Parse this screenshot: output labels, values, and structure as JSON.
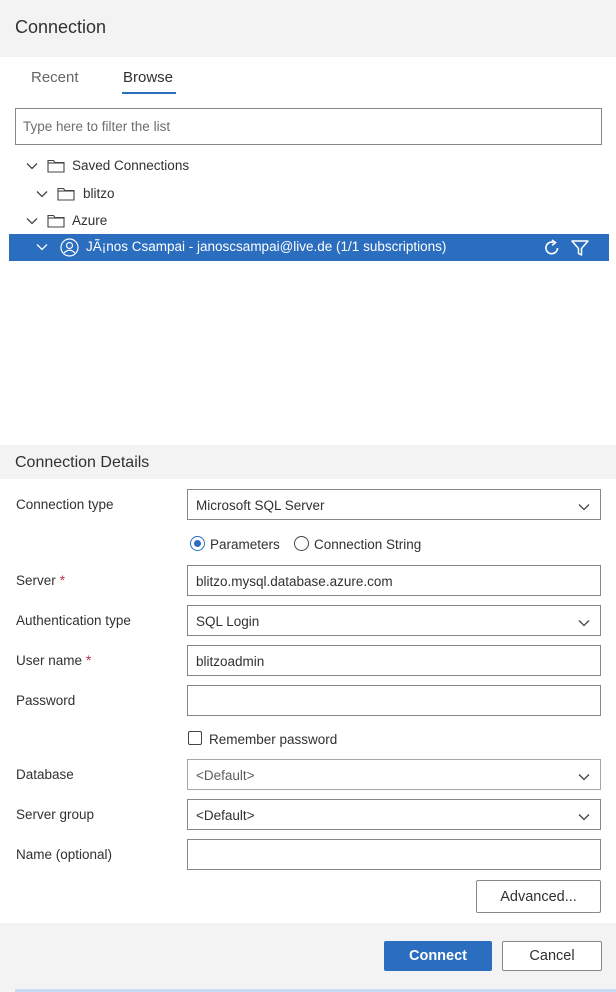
{
  "dialog": {
    "title": "Connection"
  },
  "tabs": [
    {
      "label": "Recent",
      "active": false
    },
    {
      "label": "Browse",
      "active": true
    }
  ],
  "filter": {
    "placeholder": "Type here to filter the list",
    "value": ""
  },
  "tree": {
    "saved_connections": "Saved Connections",
    "blitzo": "blitzo",
    "azure": "Azure",
    "account": "JÃ¡nos Csampai - janoscsampai@live.de (1/1 subscriptions)"
  },
  "details": {
    "title": "Connection Details",
    "connection_type": {
      "label": "Connection type",
      "value": "Microsoft SQL Server"
    },
    "input_mode": {
      "parameters": "Parameters",
      "connection_string": "Connection String",
      "selected": "Parameters"
    },
    "server": {
      "label": "Server",
      "required_mark": "*",
      "value": "blitzo.mysql.database.azure.com"
    },
    "auth_type": {
      "label": "Authentication type",
      "value": "SQL Login"
    },
    "user_name": {
      "label": "User name",
      "required_mark": "*",
      "value": "blitzoadmin"
    },
    "password": {
      "label": "Password",
      "value": ""
    },
    "remember_password": {
      "label": "Remember password",
      "checked": false
    },
    "database": {
      "label": "Database",
      "value": "<Default>"
    },
    "server_group": {
      "label": "Server group",
      "value": "<Default>"
    },
    "name": {
      "label": "Name (optional)",
      "value": ""
    },
    "advanced_label": "Advanced..."
  },
  "footer": {
    "connect_label": "Connect",
    "cancel_label": "Cancel"
  },
  "colors": {
    "accent": "#2b6dbe",
    "panel_bg": "#f3f3f3",
    "required": "#c4314b"
  },
  "icons": [
    "chevron-down-icon",
    "folder-icon",
    "account-icon",
    "refresh-icon",
    "filter-icon"
  ]
}
